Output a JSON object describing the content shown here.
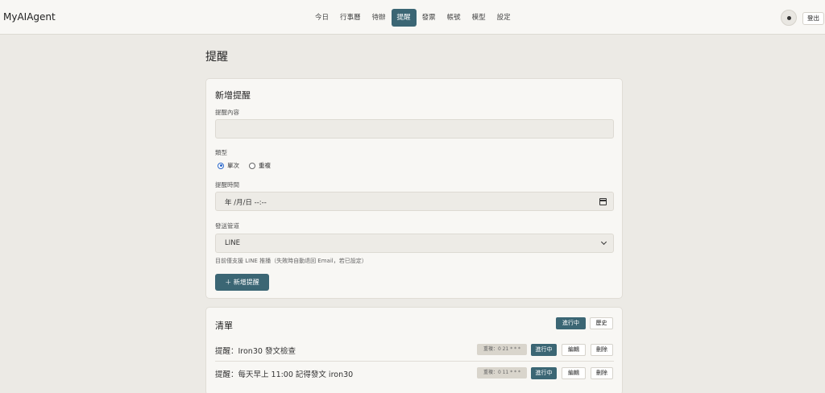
{
  "brand": "MyAIAgent",
  "nav": [
    "今日",
    "行事曆",
    "待辦",
    "提醒",
    "發票",
    "帳號",
    "模型",
    "設定"
  ],
  "nav_active": 3,
  "header": {
    "logout_label": "登出"
  },
  "page_title": "提醒",
  "new_reminder": {
    "title": "新增提醒",
    "content_label": "提醒內容",
    "content_value": "",
    "type_label": "類型",
    "type_options": [
      "單次",
      "重複"
    ],
    "type_selected": "單次",
    "time_label": "提醒時間",
    "time_value": "年 /月/日 --:--",
    "channel_label": "發送管道",
    "channel_value": "LINE",
    "hint": "目前僅支援 LINE 推播（失敗時自動退回 Email，若已設定）",
    "add_button": "＋ 新增提醒"
  },
  "list": {
    "title": "清單",
    "tab_active": "進行中",
    "tab_history": "歷史",
    "rows": [
      {
        "text": "提醒：Iron30 發文檢查",
        "badge": "重複：0 21 * * *",
        "status": "進行中",
        "edit": "編輯",
        "delete": "刪除"
      },
      {
        "text": "提醒：每天早上 11:00 記得發文 iron30",
        "badge": "重複：0 11 * * *",
        "status": "進行中",
        "edit": "編輯",
        "delete": "刪除"
      }
    ]
  },
  "colors": {
    "accent": "#3b6674",
    "background": "#eceae5",
    "card": "#f8f7f4"
  }
}
